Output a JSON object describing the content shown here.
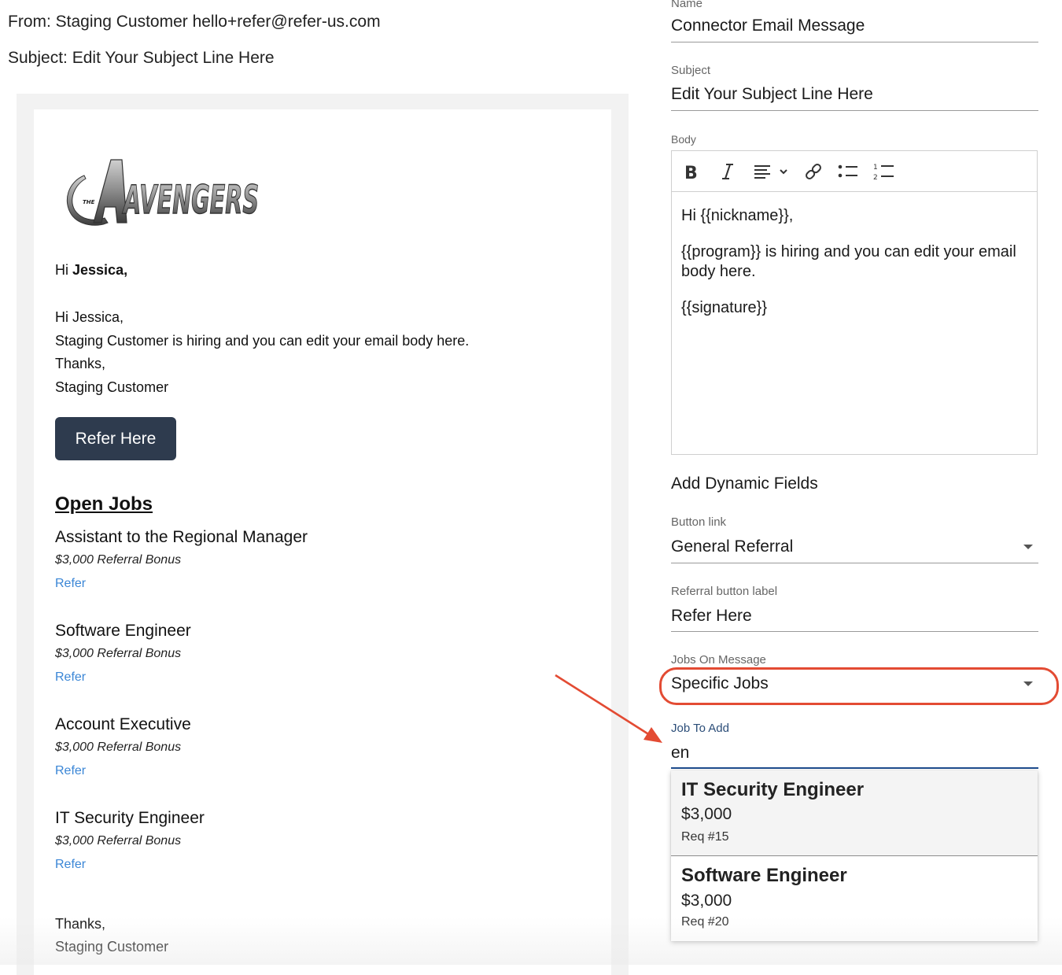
{
  "email": {
    "from": "From: Staging Customer hello+refer@refer-us.com",
    "subject": "Subject: Edit Your Subject Line Here"
  },
  "preview": {
    "logo_text": "AVENGERS",
    "logo_small_text": "THE",
    "greeting_prefix": "Hi",
    "greeting_name": "Jessica,",
    "body_lines": [
      "Hi Jessica,",
      "Staging Customer is hiring and you can edit your email body here.",
      "Thanks,",
      "Staging Customer"
    ],
    "button_label": "Refer Here",
    "open_jobs_heading": "Open Jobs",
    "jobs": [
      {
        "title": "Assistant to the Regional Manager",
        "bonus": "$3,000 Referral Bonus",
        "link": "Refer"
      },
      {
        "title": "Software Engineer",
        "bonus": "$3,000 Referral Bonus",
        "link": "Refer"
      },
      {
        "title": "Account Executive",
        "bonus": "$3,000 Referral Bonus",
        "link": "Refer"
      },
      {
        "title": "IT Security Engineer",
        "bonus": "$3,000 Referral Bonus",
        "link": "Refer"
      }
    ],
    "signoff": [
      "Thanks,",
      "Staging Customer"
    ]
  },
  "form": {
    "name_label": "Name",
    "name_value": "Connector Email Message",
    "subject_label": "Subject",
    "subject_value": "Edit Your Subject Line Here",
    "body_label": "Body",
    "toolbar_icons": [
      "bold-icon",
      "italic-icon",
      "align-icon",
      "link-icon",
      "bullet-list-icon",
      "numbered-list-icon"
    ],
    "body_paragraphs": [
      "Hi {{nickname}},",
      "{{program}} is hiring and you can edit your email body here.",
      "{{signature}}"
    ],
    "dynamic_fields_title": "Add Dynamic Fields",
    "button_link_label": "Button link",
    "button_link_value": "General Referral",
    "referral_label_label": "Referral button label",
    "referral_label_value": "Refer Here",
    "jobs_on_message_label": "Jobs On Message",
    "jobs_on_message_value": "Specific Jobs",
    "job_to_add_label": "Job To Add",
    "job_to_add_value": "en",
    "options": [
      {
        "title": "IT Security Engineer",
        "amount": "$3,000",
        "req": "Req #15"
      },
      {
        "title": "Software Engineer",
        "amount": "$3,000",
        "req": "Req #20"
      }
    ]
  },
  "colors": {
    "button_bg": "#2e3b4e",
    "link": "#3a86d6",
    "highlight": "#e34b33",
    "focus_underline": "#1f4d8f"
  }
}
